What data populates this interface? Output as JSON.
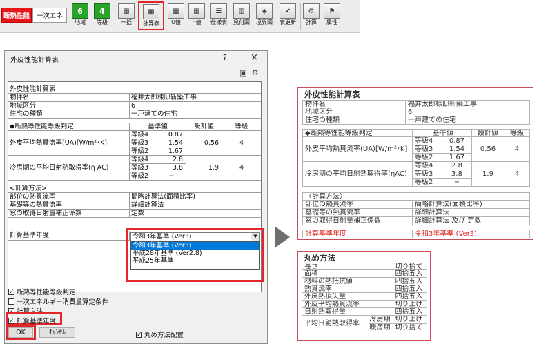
{
  "toolbar": {
    "mode_active": "断熱性能",
    "mode_other": "一次エネ",
    "region_value": "6",
    "region_label": "地域",
    "grade_value": "4",
    "grade_label": "等級",
    "buttons": [
      "一括",
      "計算表",
      "U値",
      "η値",
      "仕様表",
      "見付図",
      "境界図",
      "表更新",
      "計算",
      "属性"
    ]
  },
  "dialog": {
    "title": "外皮性能計算表",
    "help": "?",
    "close": "×",
    "table": {
      "section_title": "外皮性能計算表",
      "property_label": "物件名",
      "property_value": "福井太郎様邸新築工事",
      "region_label": "地域区分",
      "region_value": "6",
      "house_type_label": "住宅の種類",
      "house_type_value": "一戸建ての住宅",
      "grade_header": "◆断熱等性能等級判定",
      "col_standard": "基準値",
      "col_design": "設計値",
      "col_grade": "等級",
      "ua_label": "外皮平均熱貫流率(UA)[W/m²･K]",
      "ua_rows": [
        {
          "grade": "等級4",
          "value": "0.87"
        },
        {
          "grade": "等級3",
          "value": "1.54"
        },
        {
          "grade": "等級2",
          "value": "1.67"
        }
      ],
      "ua_design": "0.56",
      "ua_result": "4",
      "eta_label": "冷房期の平均日射熱取得率(η AC)",
      "eta_rows": [
        {
          "grade": "等級4",
          "value": "2.8"
        },
        {
          "grade": "等級3",
          "value": "3.8"
        },
        {
          "grade": "等級2",
          "value": "−"
        }
      ],
      "eta_design": "1.9",
      "eta_result": "4",
      "method_header": "<計算方法>",
      "method_rows": [
        {
          "label": "部位の熱貫流率",
          "value": "簡略計算法(面積比率)"
        },
        {
          "label": "基礎等の熱貫流率",
          "value": "詳細計算法"
        },
        {
          "label": "窓の取得日射量補正係数",
          "value": "定数"
        }
      ],
      "year_label": "計算基準年度"
    },
    "combo_value": "令和3年基準 (Ver3)",
    "combo_options": [
      "令和3年基準 (Ver3)",
      "平成28年基準 (Ver2.8)",
      "平成25年基準"
    ],
    "checkboxes": [
      {
        "label": "断熱等性能等級判定",
        "checked": "✓"
      },
      {
        "label": "一次エネルギー消費量算定条件",
        "checked": ""
      },
      {
        "label": "計算方法",
        "checked": "✓"
      },
      {
        "label": "計算基準年度",
        "checked": "✓"
      }
    ],
    "rounding_check": {
      "label": "丸め方法配置",
      "checked": "✓"
    },
    "ok_label": "OK",
    "cancel_label": "ｷｬﾝｾﾙ"
  },
  "preview": {
    "title": "外皮性能計算表",
    "property_label": "物件名",
    "property_value": "福井太郎様邸新築工事",
    "region_label": "地域区分",
    "region_value": "6",
    "house_type_label": "住宅の種類",
    "house_type_value": "一戸建ての住宅",
    "grade_header": "◆断熱等性能等級判定",
    "col_standard": "基準値",
    "col_design": "設計値",
    "col_grade": "等級",
    "ua_label": "外皮平均熱貫流率(UA)[W/m²･K]",
    "ua_rows": [
      {
        "grade": "等級4",
        "value": "0.87"
      },
      {
        "grade": "等級3",
        "value": "1.54"
      },
      {
        "grade": "等級2",
        "value": "1.67"
      }
    ],
    "ua_design": "0.56",
    "ua_result": "4",
    "eta_label": "冷房期の平均日射熱取得率(ηAC)",
    "eta_rows": [
      {
        "grade": "等級4",
        "value": "2.8"
      },
      {
        "grade": "等級3",
        "value": "3.8"
      },
      {
        "grade": "等級2",
        "value": "−"
      }
    ],
    "eta_design": "1.9",
    "eta_result": "4",
    "method_header": "〈計算方法〉",
    "method_rows": [
      {
        "label": "部位の熱貫流率",
        "value": "簡略計算法(面積比率)"
      },
      {
        "label": "基礎等の熱貫流率",
        "value": "詳細計算法"
      },
      {
        "label": "窓の取得日射量補正係数",
        "value": "詳細計算法 及び 定数"
      }
    ],
    "year_label": "計算基準年度",
    "year_value": "令和3年基準 (Ver3)"
  },
  "rounding": {
    "title": "丸め方法",
    "rows": [
      {
        "label": "長さ",
        "value": "切り捨て"
      },
      {
        "label": "面積",
        "value": "四捨五入"
      },
      {
        "label": "材料の熱抵抗値",
        "value": "四捨五入"
      },
      {
        "label": "熱貫流率",
        "value": "四捨五入"
      },
      {
        "label": "外皮熱損失量",
        "value": "四捨五入"
      },
      {
        "label": "外皮平均熱貫流率",
        "value": "切り上げ"
      },
      {
        "label": "日射熱取得量",
        "value": "四捨五入"
      }
    ],
    "last_label": "平均日射熱取得率",
    "last_rows": [
      {
        "label": "冷房期",
        "value": "切り上げ"
      },
      {
        "label": "暖房期",
        "value": "切り捨て"
      }
    ]
  },
  "colors": {
    "highlight": "#e3262a",
    "toolbar_green": "#29a329",
    "mode_red": "#e8151b",
    "preview_border": "#c64a58"
  }
}
